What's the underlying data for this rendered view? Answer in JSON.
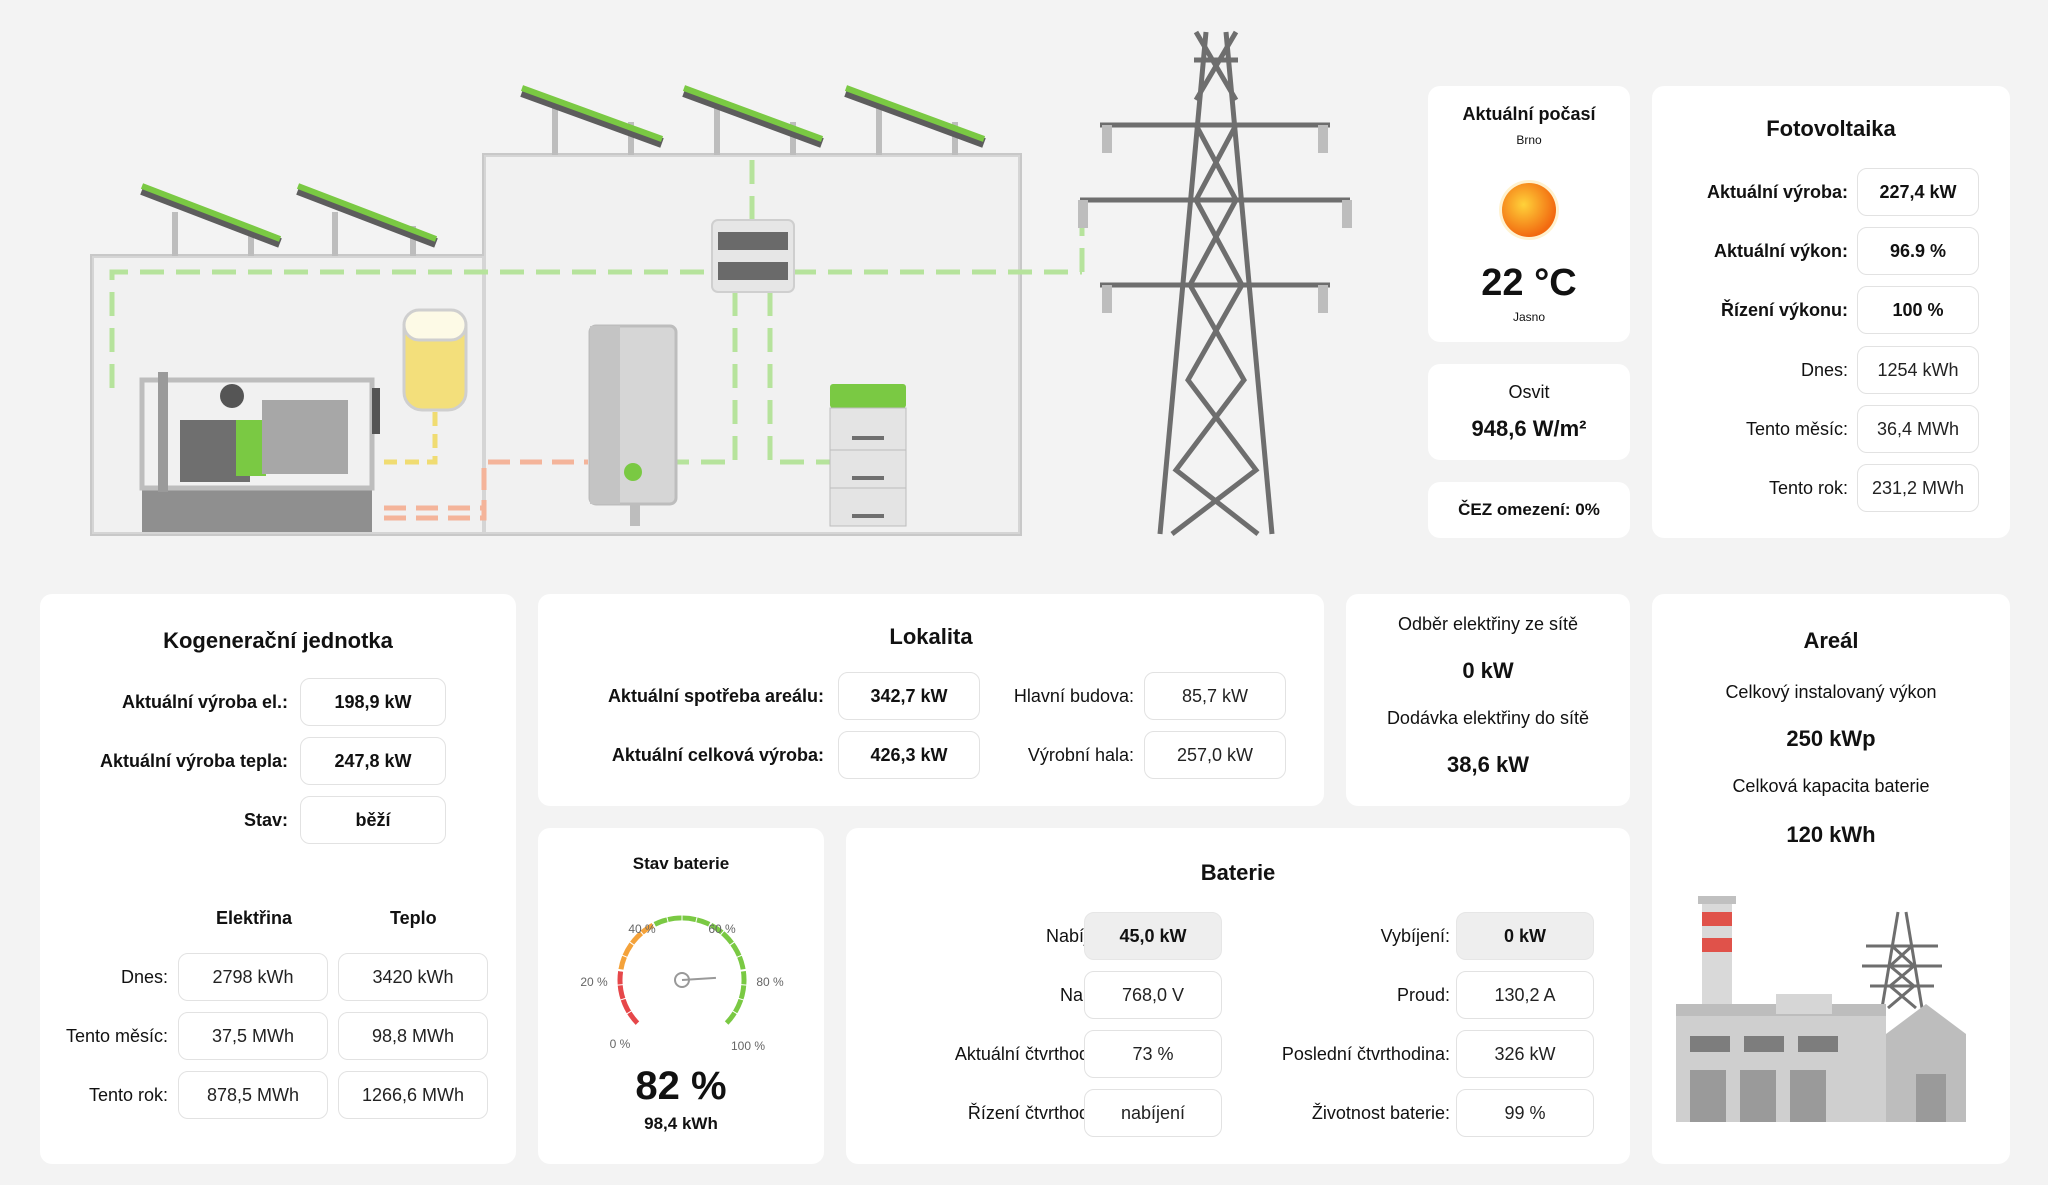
{
  "weather": {
    "title": "Aktuální počasí",
    "city": "Brno",
    "temp": "22 °C",
    "desc": "Jasno",
    "icon": "sun-icon"
  },
  "osvit": {
    "label": "Osvit",
    "value": "948,6 W/m²"
  },
  "cez": {
    "label": "ČEZ omezení: 0%"
  },
  "fve": {
    "title": "Fotovoltaika",
    "rows": [
      {
        "label": "Aktuální výroba:",
        "value": "227,4 kW"
      },
      {
        "label": "Aktuální výkon:",
        "value": "96.9 %"
      },
      {
        "label": "Řízení výkonu:",
        "value": "100 %"
      },
      {
        "label": "Dnes:",
        "value": "1254 kWh"
      },
      {
        "label": "Tento měsíc:",
        "value": "36,4 MWh"
      },
      {
        "label": "Tento rok:",
        "value": "231,2 MWh"
      }
    ]
  },
  "kgj": {
    "title": "Kogenerační jednotka",
    "rows": [
      {
        "label": "Aktuální výroba el.:",
        "value": "198,9 kW"
      },
      {
        "label": "Aktuální výroba tepla:",
        "value": "247,8 kW"
      },
      {
        "label": "Stav:",
        "value": "běží"
      }
    ],
    "col_el": "Elektřina",
    "col_heat": "Teplo",
    "stats": [
      {
        "label": "Dnes:",
        "el": "2798 kWh",
        "heat": "3420 kWh"
      },
      {
        "label": "Tento měsíc:",
        "el": "37,5 MWh",
        "heat": "98,8 MWh"
      },
      {
        "label": "Tento rok:",
        "el": "878,5 MWh",
        "heat": "1266,6 MWh"
      }
    ]
  },
  "lokalita": {
    "title": "Lokalita",
    "spotreba_label": "Aktuální spotřeba areálu:",
    "spotreba": "342,7 kW",
    "vyroba_label": "Aktuální celková výroba:",
    "vyroba": "426,3 kW",
    "budova_label": "Hlavní budova:",
    "budova": "85,7 kW",
    "hala_label": "Výrobní hala:",
    "hala": "257,0 kW"
  },
  "grid": {
    "odber_label": "Odběr elektřiny ze sítě",
    "odber": "0 kW",
    "dodavka_label": "Dodávka elektřiny do sítě",
    "dodavka": "38,6 kW"
  },
  "areal": {
    "title": "Areál",
    "installed_label": "Celkový instalovaný výkon",
    "installed": "250 kWp",
    "capacity_label": "Celková kapacita baterie",
    "capacity": "120 kWh"
  },
  "battery_state": {
    "title": "Stav baterie",
    "percent_text": "82 %",
    "percent": 82,
    "energy": "98,4 kWh",
    "ticks": [
      "0 %",
      "20 %",
      "40 %",
      "60 %",
      "80 %",
      "100 %"
    ]
  },
  "baterie": {
    "title": "Baterie",
    "left": [
      {
        "label": "Nabíjení:",
        "value": "45,0 kW"
      },
      {
        "label": "Napětí:",
        "value": "768,0 V"
      },
      {
        "label": "Aktuální čtvrthodina:",
        "value": "73 %"
      },
      {
        "label": "Řízení čtvrthodina:",
        "value": "nabíjení"
      }
    ],
    "right": [
      {
        "label": "Vybíjení:",
        "value": "0 kW"
      },
      {
        "label": "Proud:",
        "value": "130,2 A"
      },
      {
        "label": "Poslední čtvrthodina:",
        "value": "326 kW"
      },
      {
        "label": "Životnost baterie:",
        "value": "99 %"
      }
    ]
  },
  "colors": {
    "accent": "#6cc63a",
    "card": "#ffffff",
    "background": "#f3f3f3",
    "heat": "#f29a78",
    "gas": "#f3df7b"
  }
}
